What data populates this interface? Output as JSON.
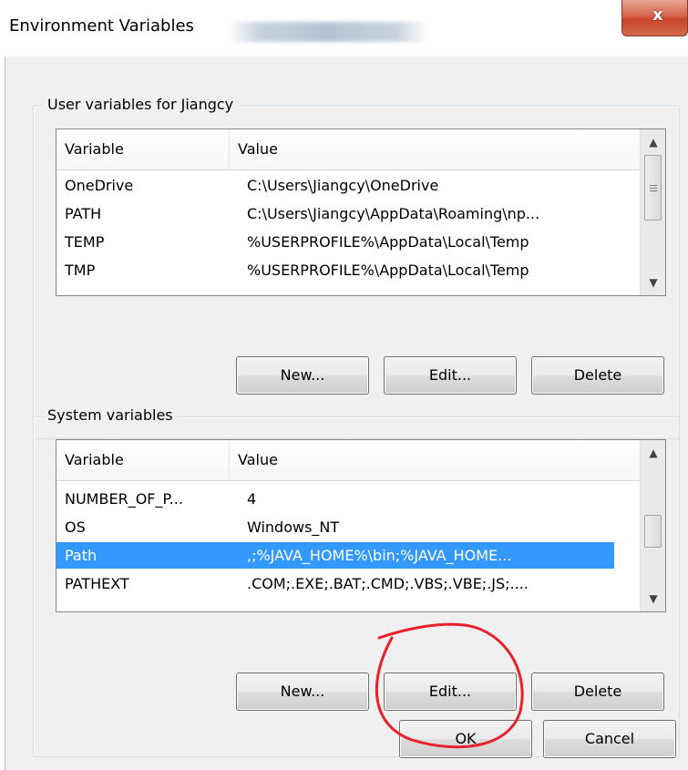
{
  "window": {
    "title": "Environment Variables",
    "close_symbol": "x"
  },
  "user_group": {
    "label": "User variables for Jiangcy",
    "columns": [
      "Variable",
      "Value"
    ],
    "rows": [
      {
        "variable": "OneDrive",
        "value": "C:\\Users\\Jiangcy\\OneDrive"
      },
      {
        "variable": "PATH",
        "value": "C:\\Users\\Jiangcy\\AppData\\Roaming\\np..."
      },
      {
        "variable": "TEMP",
        "value": "%USERPROFILE%\\AppData\\Local\\Temp"
      },
      {
        "variable": "TMP",
        "value": "%USERPROFILE%\\AppData\\Local\\Temp"
      }
    ],
    "buttons": {
      "new": "New...",
      "edit": "Edit...",
      "delete": "Delete"
    }
  },
  "system_group": {
    "label": "System variables",
    "columns": [
      "Variable",
      "Value"
    ],
    "rows": [
      {
        "variable": "NUMBER_OF_P...",
        "value": "4"
      },
      {
        "variable": "OS",
        "value": "Windows_NT"
      },
      {
        "variable": "Path",
        "value": ",;%JAVA_HOME%\\bin;%JAVA_HOME...",
        "selected": true
      },
      {
        "variable": "PATHEXT",
        "value": ".COM;.EXE;.BAT;.CMD;.VBS;.VBE;.JS;...."
      }
    ],
    "buttons": {
      "new": "New...",
      "edit": "Edit...",
      "delete": "Delete"
    }
  },
  "footer": {
    "ok": "OK",
    "cancel": "Cancel"
  },
  "colors": {
    "selection": "#3399ff",
    "annotation": "#e8202a",
    "close_button": "#c6442a"
  }
}
